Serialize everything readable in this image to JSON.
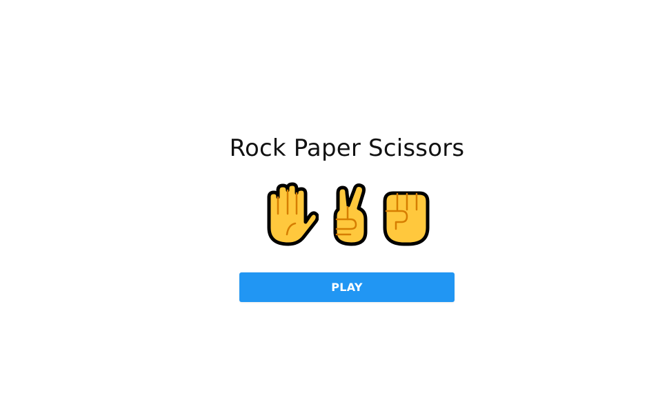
{
  "game": {
    "title": "Rock Paper Scissors",
    "play_label": "PLAY",
    "hands": [
      {
        "name": "paper-hand-icon",
        "glyph": "raised hand"
      },
      {
        "name": "scissors-hand-icon",
        "glyph": "victory hand"
      },
      {
        "name": "rock-hand-icon",
        "glyph": "raised fist"
      }
    ]
  },
  "colors": {
    "button": "#2196f3",
    "skin": "#FFC83D",
    "crease": "#D67D00",
    "outline": "#000000"
  }
}
